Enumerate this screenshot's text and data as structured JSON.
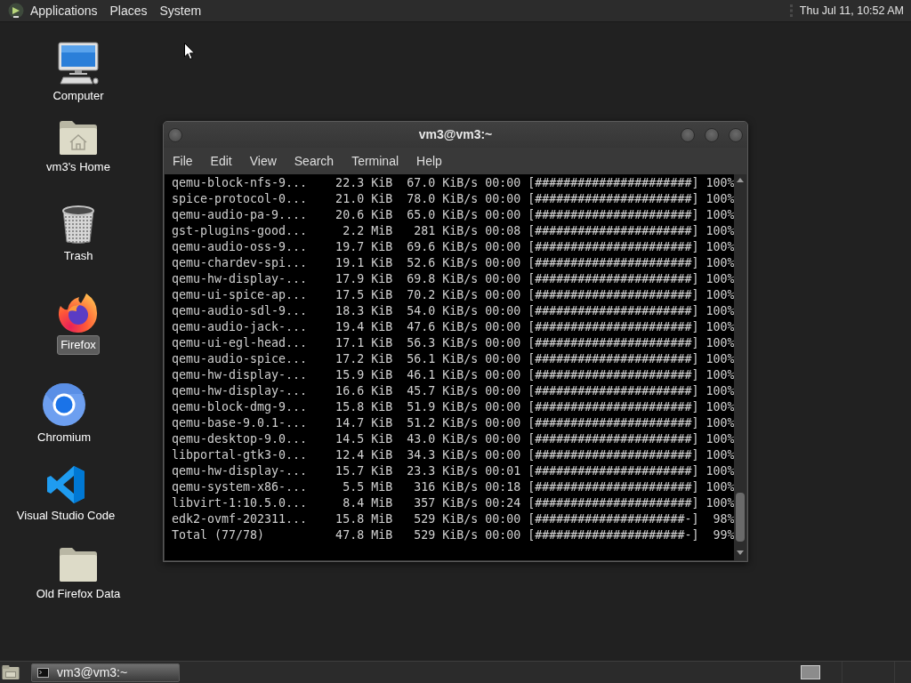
{
  "top_panel": {
    "menus": [
      "Applications",
      "Places",
      "System"
    ],
    "clock": "Thu Jul 11, 10:52 AM"
  },
  "desktop_icons": [
    {
      "kind": "computer",
      "label": "Computer",
      "selected": false
    },
    {
      "kind": "home",
      "label": "vm3's Home",
      "selected": false
    },
    {
      "kind": "trash",
      "label": "Trash",
      "selected": false
    },
    {
      "kind": "firefox",
      "label": "Firefox",
      "selected": true
    },
    {
      "kind": "chromium",
      "label": "Chromium",
      "selected": false
    },
    {
      "kind": "vscode",
      "label": "Visual Studio Code",
      "selected": false
    },
    {
      "kind": "folder",
      "label": "Old Firefox Data",
      "selected": false
    }
  ],
  "terminal_window": {
    "title": "vm3@vm3:~",
    "menus": [
      "File",
      "Edit",
      "View",
      "Search",
      "Terminal",
      "Help"
    ],
    "lines": [
      "qemu-block-nfs-9...    22.3 KiB  67.0 KiB/s 00:00 [######################] 100%",
      "spice-protocol-0...    21.0 KiB  78.0 KiB/s 00:00 [######################] 100%",
      "qemu-audio-pa-9....    20.6 KiB  65.0 KiB/s 00:00 [######################] 100%",
      "gst-plugins-good...     2.2 MiB   281 KiB/s 00:08 [######################] 100%",
      "qemu-audio-oss-9...    19.7 KiB  69.6 KiB/s 00:00 [######################] 100%",
      "qemu-chardev-spi...    19.1 KiB  52.6 KiB/s 00:00 [######################] 100%",
      "qemu-hw-display-...    17.9 KiB  69.8 KiB/s 00:00 [######################] 100%",
      "qemu-ui-spice-ap...    17.5 KiB  70.2 KiB/s 00:00 [######################] 100%",
      "qemu-audio-sdl-9...    18.3 KiB  54.0 KiB/s 00:00 [######################] 100%",
      "qemu-audio-jack-...    19.4 KiB  47.6 KiB/s 00:00 [######################] 100%",
      "qemu-ui-egl-head...    17.1 KiB  56.3 KiB/s 00:00 [######################] 100%",
      "qemu-audio-spice...    17.2 KiB  56.1 KiB/s 00:00 [######################] 100%",
      "qemu-hw-display-...    15.9 KiB  46.1 KiB/s 00:00 [######################] 100%",
      "qemu-hw-display-...    16.6 KiB  45.7 KiB/s 00:00 [######################] 100%",
      "qemu-block-dmg-9...    15.8 KiB  51.9 KiB/s 00:00 [######################] 100%",
      "qemu-base-9.0.1-...    14.7 KiB  51.2 KiB/s 00:00 [######################] 100%",
      "qemu-desktop-9.0...    14.5 KiB  43.0 KiB/s 00:00 [######################] 100%",
      "libportal-gtk3-0...    12.4 KiB  34.3 KiB/s 00:00 [######################] 100%",
      "qemu-hw-display-...    15.7 KiB  23.3 KiB/s 00:01 [######################] 100%",
      "qemu-system-x86-...     5.5 MiB   316 KiB/s 00:18 [######################] 100%",
      "libvirt-1:10.5.0...     8.4 MiB   357 KiB/s 00:24 [######################] 100%",
      "edk2-ovmf-202311...    15.8 MiB   529 KiB/s 00:00 [#####################-]  98%",
      "Total (77/78)          47.8 MiB   529 KiB/s 00:00 [#####################-]  99%"
    ]
  },
  "bottom_panel": {
    "tasks": [
      {
        "label": "vm3@vm3:~",
        "selected": true
      }
    ]
  }
}
